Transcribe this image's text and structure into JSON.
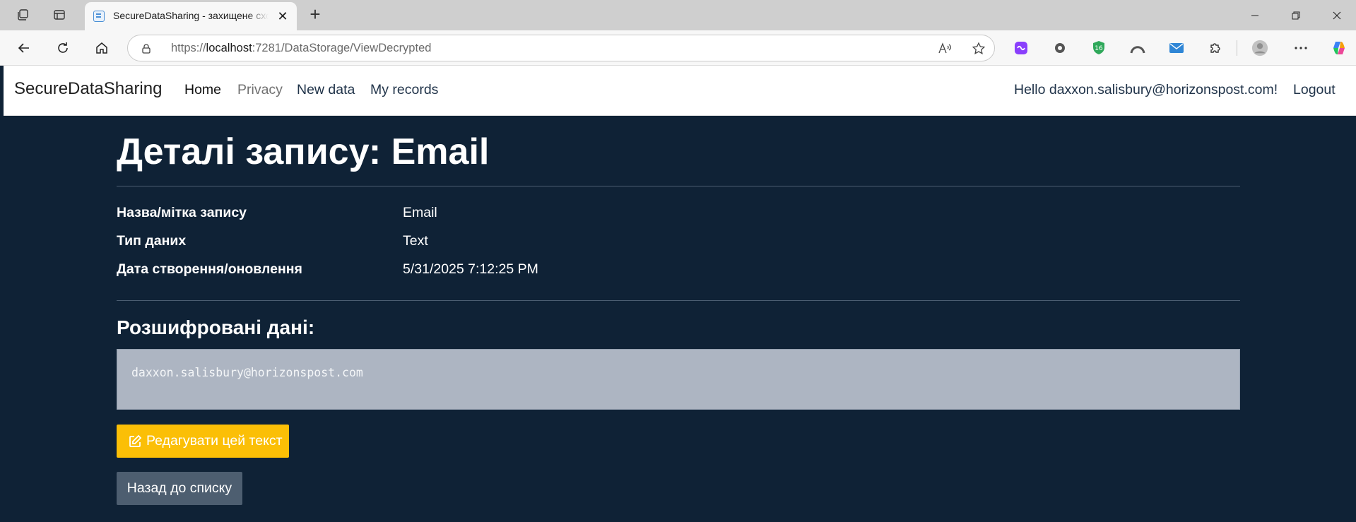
{
  "browser": {
    "tab_title": "SecureDataSharing - захищене сховище",
    "url_scheme": "https://",
    "url_host": "localhost",
    "url_rest": ":7281/DataStorage/ViewDecrypted",
    "extension_badge": "16"
  },
  "navbar": {
    "brand": "SecureDataSharing",
    "links": [
      "Home",
      "Privacy",
      "New data",
      "My records"
    ],
    "greeting": "Hello daxxon.salisbury@horizonspost.com!",
    "logout": "Logout"
  },
  "details": {
    "title_bold": "Деталі запису:",
    "title_name": "Email",
    "rows": [
      {
        "label": "Назва/мітка запису",
        "value": "Email"
      },
      {
        "label": "Тип даних",
        "value": "Text"
      },
      {
        "label": "Дата створення/оновлення",
        "value": "5/31/2025 7:12:25 PM"
      }
    ],
    "decrypted_heading": "Розшифровані дані:",
    "decrypted_value": "daxxon.salisbury@horizonspost.com",
    "edit_button": "Редагувати цей текст",
    "back_button": "Назад до списку"
  },
  "colors": {
    "page_bg": "#0f2236",
    "edit_button": "#fbbf06",
    "back_button": "#4d5e70",
    "decrypted_box": "#adb5c2"
  }
}
